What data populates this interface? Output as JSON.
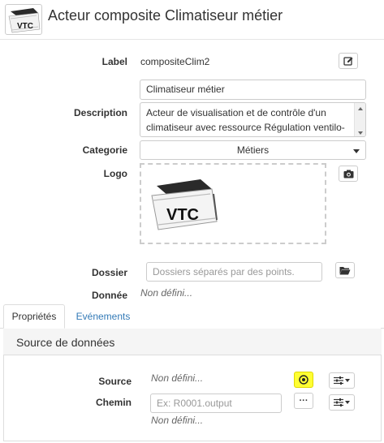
{
  "header": {
    "title": "Acteur composite Climatiseur métier",
    "logo_text": "VTC"
  },
  "form": {
    "label": {
      "label": "Label",
      "value": "compositeClim2"
    },
    "name_input": {
      "value": "Climatiseur métier"
    },
    "description": {
      "label": "Description",
      "line1": "Acteur de visualisation et de contrôle d'un",
      "line2": "climatiseur avec ressource Régulation ventilo-"
    },
    "categorie": {
      "label": "Categorie",
      "value": "Métiers"
    },
    "logo": {
      "label": "Logo",
      "image_text": "VTC"
    },
    "dossier": {
      "label": "Dossier",
      "placeholder": "Dossiers séparés par des points."
    },
    "donnee": {
      "label": "Donnée",
      "value": "Non défini..."
    }
  },
  "tabs": {
    "proprietes": "Propriétés",
    "evenements": "Evénements"
  },
  "source_panel": {
    "title": "Source de données",
    "source": {
      "label": "Source",
      "value": "Non défini..."
    },
    "chemin": {
      "label": "Chemin",
      "placeholder": "Ex: R0001.output",
      "value": "Non défini...",
      "button": "···"
    }
  },
  "colors": {
    "link": "#337ab7",
    "highlight": "#ffff33"
  }
}
